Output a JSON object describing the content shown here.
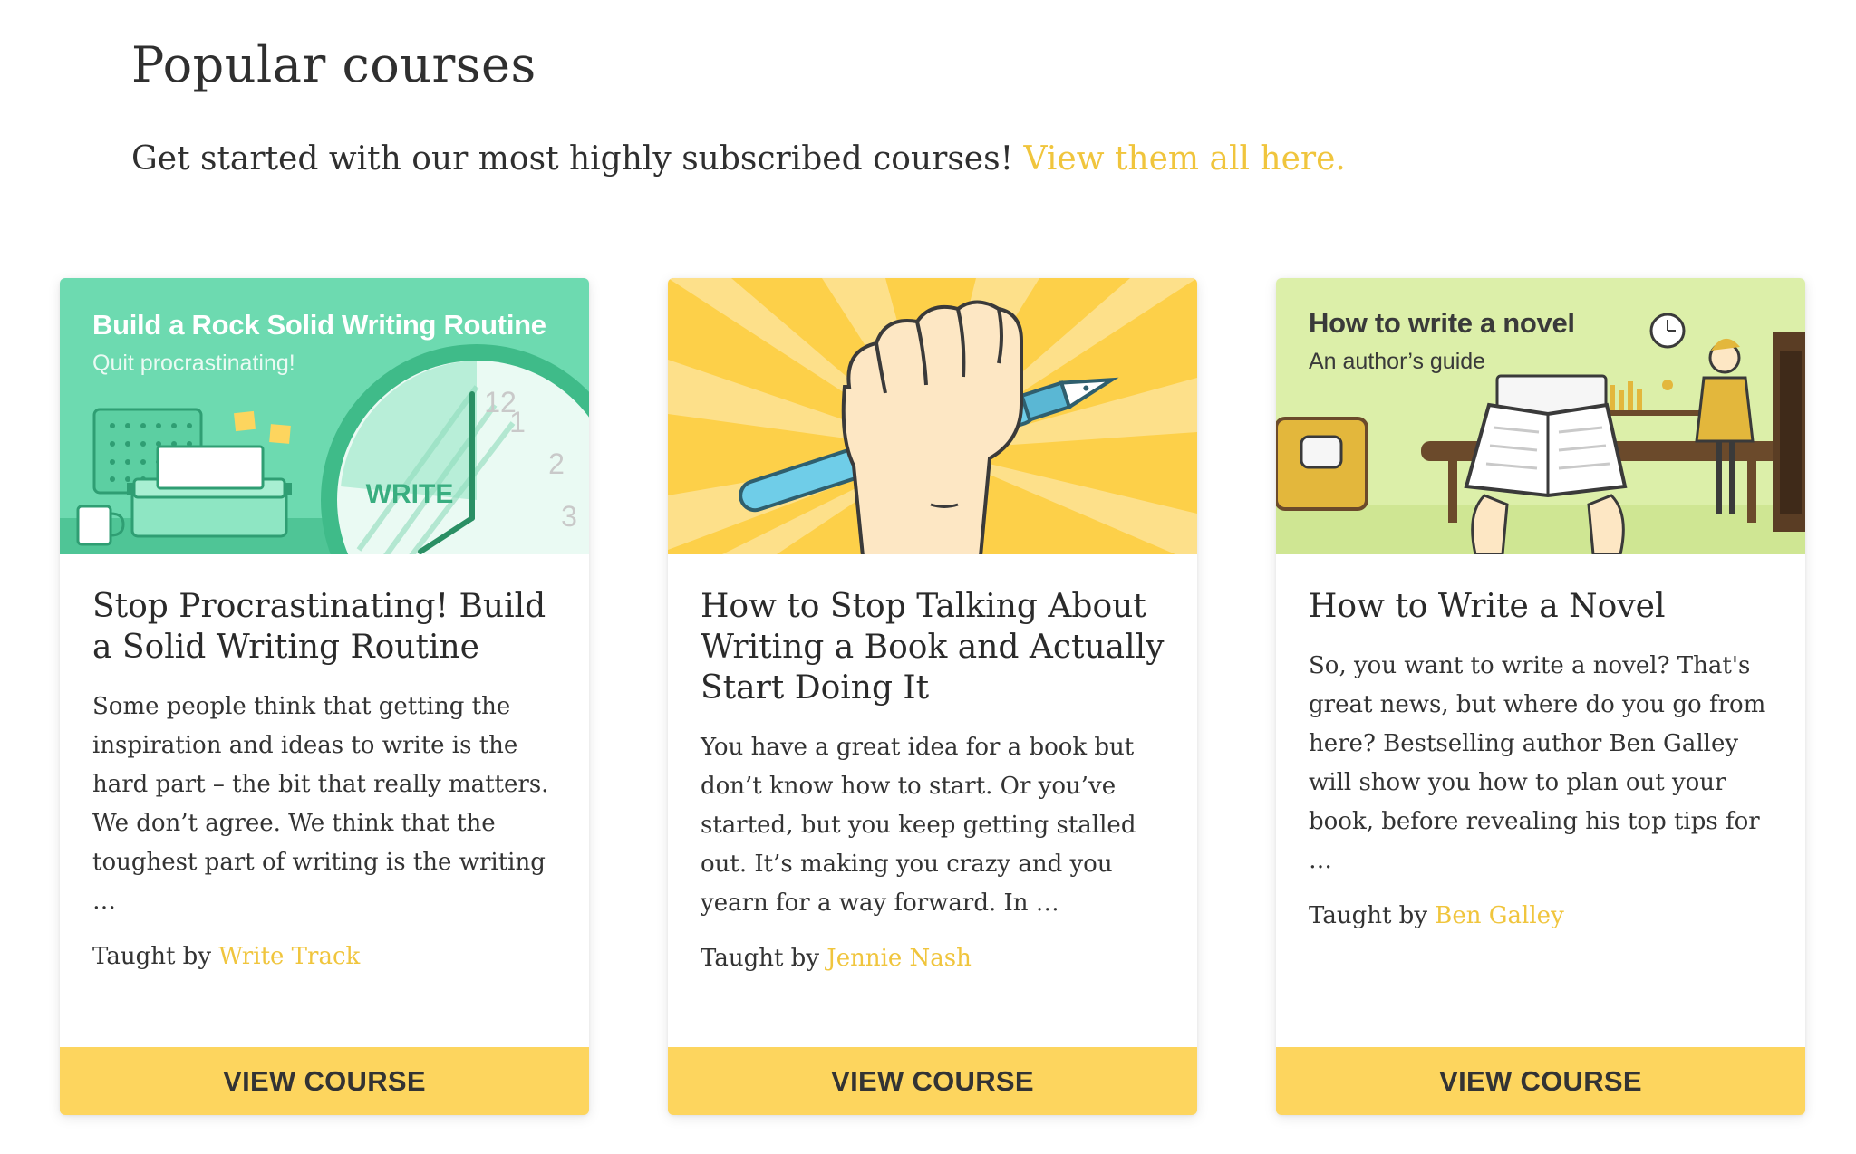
{
  "heading": "Popular courses",
  "subtitle": {
    "text": "Get started with our most highly subscribed courses!",
    "link": "View them all here."
  },
  "colors": {
    "accent": "#f0c53d",
    "button": "#fdd55e",
    "card1_banner": "#6ddab0",
    "card2_banner": "#fdd049",
    "card3_banner": "#dcefa9"
  },
  "courses": [
    {
      "banner_title": "Build a Rock Solid Writing Routine",
      "banner_subtitle": "Quit procrastinating!",
      "banner_clock_word": "WRITE",
      "clock_numbers": [
        "12",
        "1",
        "2",
        "3"
      ],
      "title": "Stop Procrastinating! Build a Solid Writing Routine",
      "description": "Some people think that getting the inspiration and ideas to write is the hard part – the bit that really matters. We don’t agree. We think that the toughest part of writing is the writing …",
      "author_prefix": "Taught by",
      "author": "Write Track",
      "button": "VIEW COURSE",
      "image_icon": "typewriter-clock-illustration"
    },
    {
      "banner_title": "",
      "banner_subtitle": "",
      "title": "How to Stop Talking About Writing a Book and Actually Start Doing It",
      "description": "You have a great idea for a book but don’t know how to start. Or you’ve started, but you keep getting stalled out. It’s making you crazy and you yearn for a way forward.  In …",
      "author_prefix": "Taught by",
      "author": "Jennie Nash",
      "button": "VIEW COURSE",
      "image_icon": "fist-holding-pen-illustration"
    },
    {
      "banner_title": "How to write a novel",
      "banner_subtitle": "An author’s guide",
      "title": "How to Write a Novel",
      "description": "So, you want to write a novel? That's great news, but where do you go from here? Bestselling author Ben Galley will show you how to plan out your book, before revealing his top tips for …",
      "author_prefix": "Taught by",
      "author": "Ben Galley",
      "button": "VIEW COURSE",
      "image_icon": "open-book-study-illustration"
    }
  ]
}
